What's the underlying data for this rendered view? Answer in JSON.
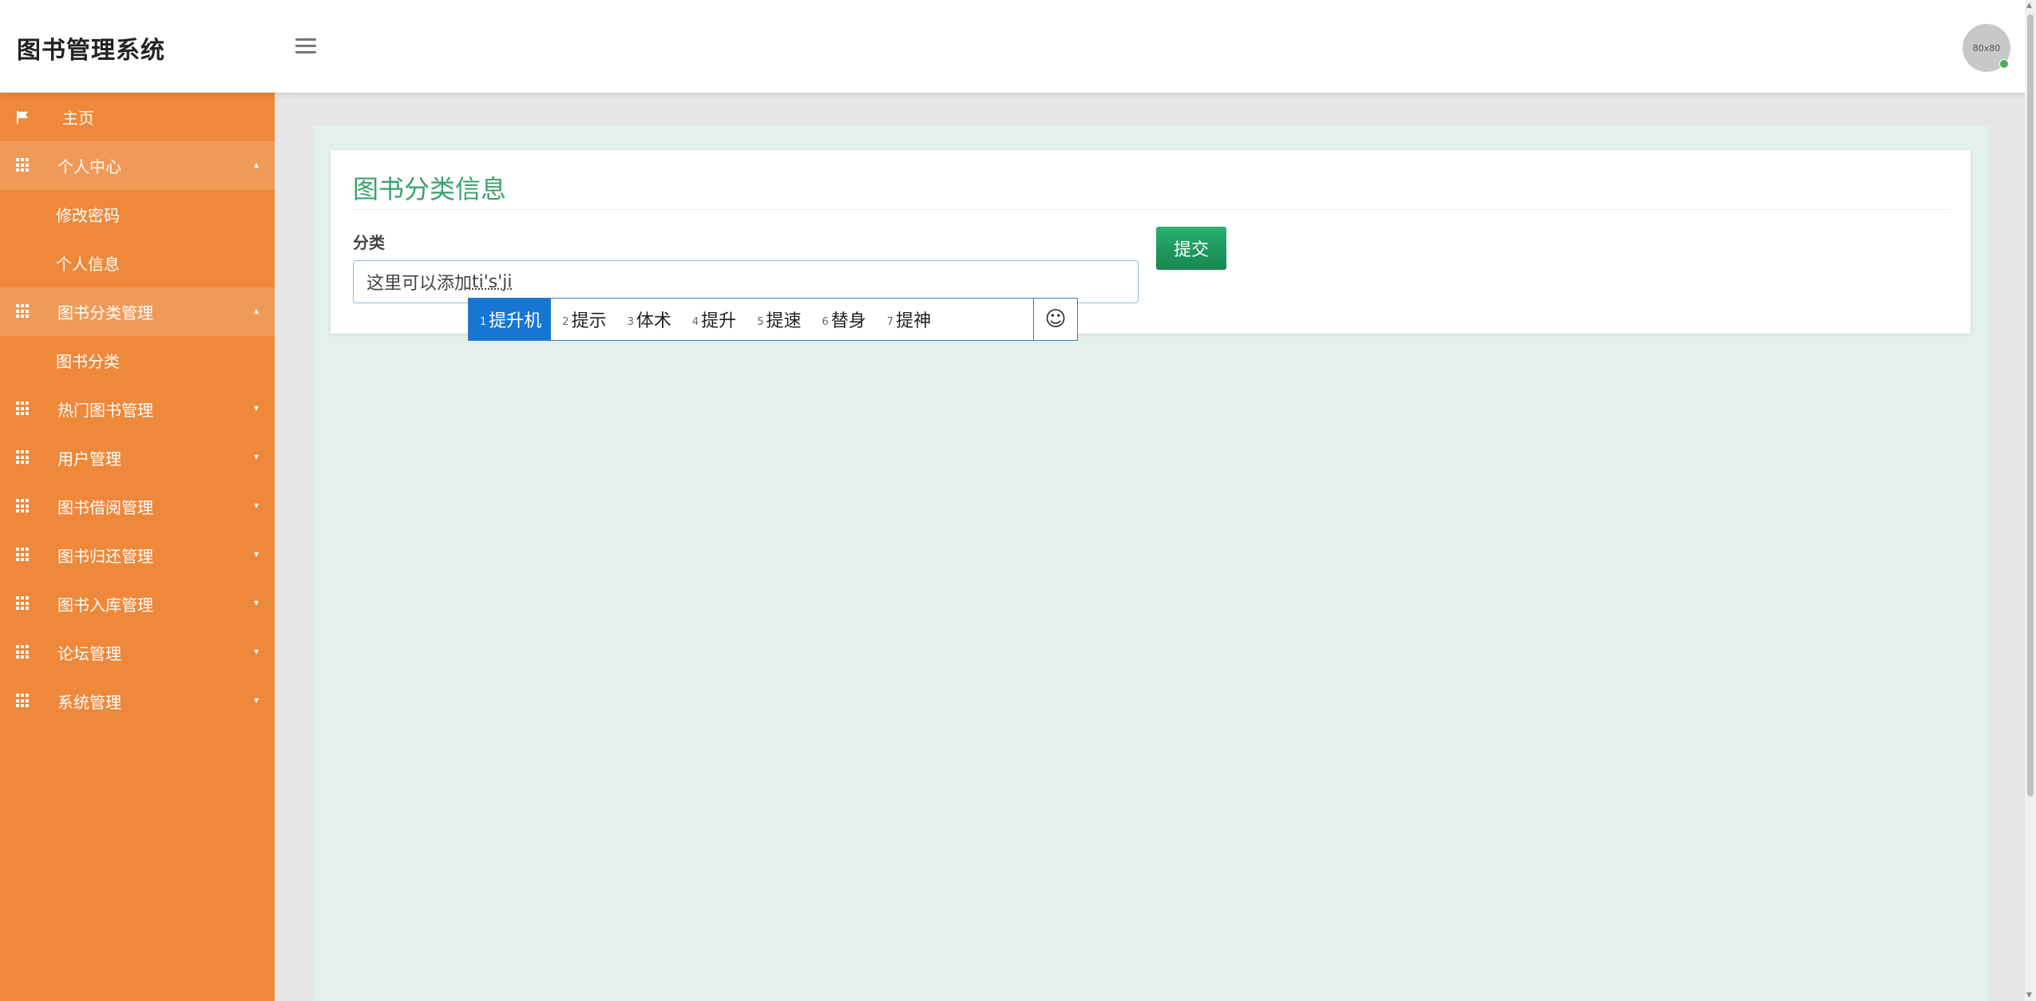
{
  "header": {
    "title": "图书管理系统",
    "avatar_text": "80x80"
  },
  "sidebar": {
    "items": [
      {
        "label": "主页",
        "icon": "flag-icon"
      },
      {
        "label": "个人中心",
        "icon": "grid-icon",
        "expanded": true,
        "children": [
          {
            "label": "修改密码"
          },
          {
            "label": "个人信息"
          }
        ]
      },
      {
        "label": "图书分类管理",
        "icon": "grid-icon",
        "expanded": true,
        "children": [
          {
            "label": "图书分类"
          }
        ]
      },
      {
        "label": "热门图书管理",
        "icon": "grid-icon"
      },
      {
        "label": "用户管理",
        "icon": "grid-icon"
      },
      {
        "label": "图书借阅管理",
        "icon": "grid-icon"
      },
      {
        "label": "图书归还管理",
        "icon": "grid-icon"
      },
      {
        "label": "图书入库管理",
        "icon": "grid-icon"
      },
      {
        "label": "论坛管理",
        "icon": "grid-icon"
      },
      {
        "label": "系统管理",
        "icon": "grid-icon"
      }
    ]
  },
  "form": {
    "title": "图书分类信息",
    "field_label": "分类",
    "input_text": "这里可以添加",
    "input_composition": "ti's'ji",
    "submit_label": "提交"
  },
  "ime": {
    "candidates": [
      {
        "num": "1",
        "text": "提升机"
      },
      {
        "num": "2",
        "text": "提示"
      },
      {
        "num": "3",
        "text": "体术"
      },
      {
        "num": "4",
        "text": "提升"
      },
      {
        "num": "5",
        "text": "提速"
      },
      {
        "num": "6",
        "text": "替身"
      },
      {
        "num": "7",
        "text": "提神"
      }
    ],
    "emoji": "☺"
  },
  "colors": {
    "sidebar": "#ee883a",
    "sidebar_open": "#f09a58",
    "title_green": "#3aa26b",
    "button_green": "#1e9a5f",
    "ime_selected": "#1677d2"
  }
}
